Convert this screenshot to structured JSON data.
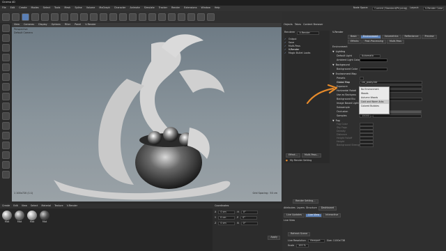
{
  "app": {
    "title": "Cinema 4D",
    "menus": [
      "File",
      "Edit",
      "Create",
      "Modes",
      "Select",
      "Tools",
      "Mesh",
      "Spline",
      "Volume",
      "MoGraph",
      "Character",
      "Animate",
      "Simulate",
      "Tracker",
      "Render",
      "Extensions",
      "Window",
      "Help"
    ],
    "node_space_label": "Node Space:",
    "node_space_value": "Current (Standard/Physical)",
    "layout_label": "Layout:",
    "layout_value": "V-Render Color"
  },
  "viewport": {
    "menu": [
      "View",
      "Cameras",
      "Display",
      "Options",
      "Filter",
      "Panel",
      "V-Render"
    ],
    "name": "Perspective",
    "camera": "Default Camera",
    "grid_spacing": "Grid Spacing : 50 cm",
    "coords": "1 100x720 (1:1)"
  },
  "objects_panel": {
    "tabs": [
      "Objects",
      "Takes",
      "Content Browser"
    ],
    "renderer_label": "Renderer",
    "renderer_value": "V-Render",
    "items": [
      "Output",
      "Save",
      "Multi-Pass",
      "V-Render",
      "Magic Bullet Looks"
    ],
    "effect_button": "Effect...",
    "multipass_button": "Multi-Pass...",
    "my_render_setting": "My Render Setting",
    "render_setting_button": "Render Setting..."
  },
  "vray_panel": {
    "header": "V-Render",
    "tabs": [
      "Basic",
      "Environment",
      "Volumetrics",
      "Reflectance",
      "Preview",
      "Effects",
      "Post-Processing",
      "Multi-Pass"
    ],
    "active_tab": "Environment",
    "section_environment": "Environment",
    "lighting": "Lighting",
    "default_light": "Default Light",
    "default_light_value": "Automatic",
    "ambient_light_color": "Ambient Light Color",
    "background": "Background",
    "background_color": "Background Color",
    "environment_map": "Environment Map",
    "presets": "Presets",
    "global_map": "Global Map",
    "global_map_value": "cm_pssky.hdr",
    "exposure": "Exposure",
    "horizontal_rotation": "Horizontal Rotati",
    "use_as_background": "Use as Backgrou",
    "background_blur": "Background Blu",
    "image_based_lighting": "Image Based Lighting",
    "subsample": "Subsample",
    "occlusion": "Occlusion",
    "occlusion_value": "100 %",
    "samples": "Samples",
    "samples_value": "15000",
    "fog": "Fog",
    "fog_params": [
      "Fog Color",
      "Sky Fogs",
      "Density",
      "Distance",
      "Height Falloff",
      "Height",
      "Background Strength"
    ]
  },
  "dropdown": {
    "options": [
      "No Environment",
      "Woods",
      "Autumn Woods",
      "Cold and Warm Arbs",
      "Colored Bubbles"
    ],
    "selected_index": 3
  },
  "bottom": {
    "materials_menu": [
      "Create",
      "Edit",
      "View",
      "Select",
      "Material",
      "Texture",
      "V-Render"
    ],
    "materials": [
      "Mat",
      "Mat",
      "Mat",
      "Mat"
    ],
    "coords_title": "Coordinates",
    "coords_labels": [
      "X",
      "Y",
      "Z"
    ],
    "coords_values": [
      "0 cm",
      "0 cm",
      "0 cm"
    ],
    "size_labels": [
      "H",
      "P",
      "B"
    ],
    "size_values": [
      "0°",
      "0°",
      "0°"
    ],
    "apply_button": "Apply",
    "attributes_tabs": [
      "Attributes",
      "Layers",
      "Structure",
      "Dashboard"
    ],
    "live_tabs": [
      "Live Updates",
      "Live View",
      "Interactive"
    ],
    "live_view_label": "Live View",
    "refresh_button": "Refresh Scene",
    "live_resolution_label": "Live Resolution",
    "live_resolution_value": "Viewport",
    "size_label": "Size: 1100x738",
    "scale_label": "Scale",
    "scale_value": "100 %"
  },
  "colors": {
    "accent": "#5a7fb5",
    "arrow": "#e58a2b"
  }
}
